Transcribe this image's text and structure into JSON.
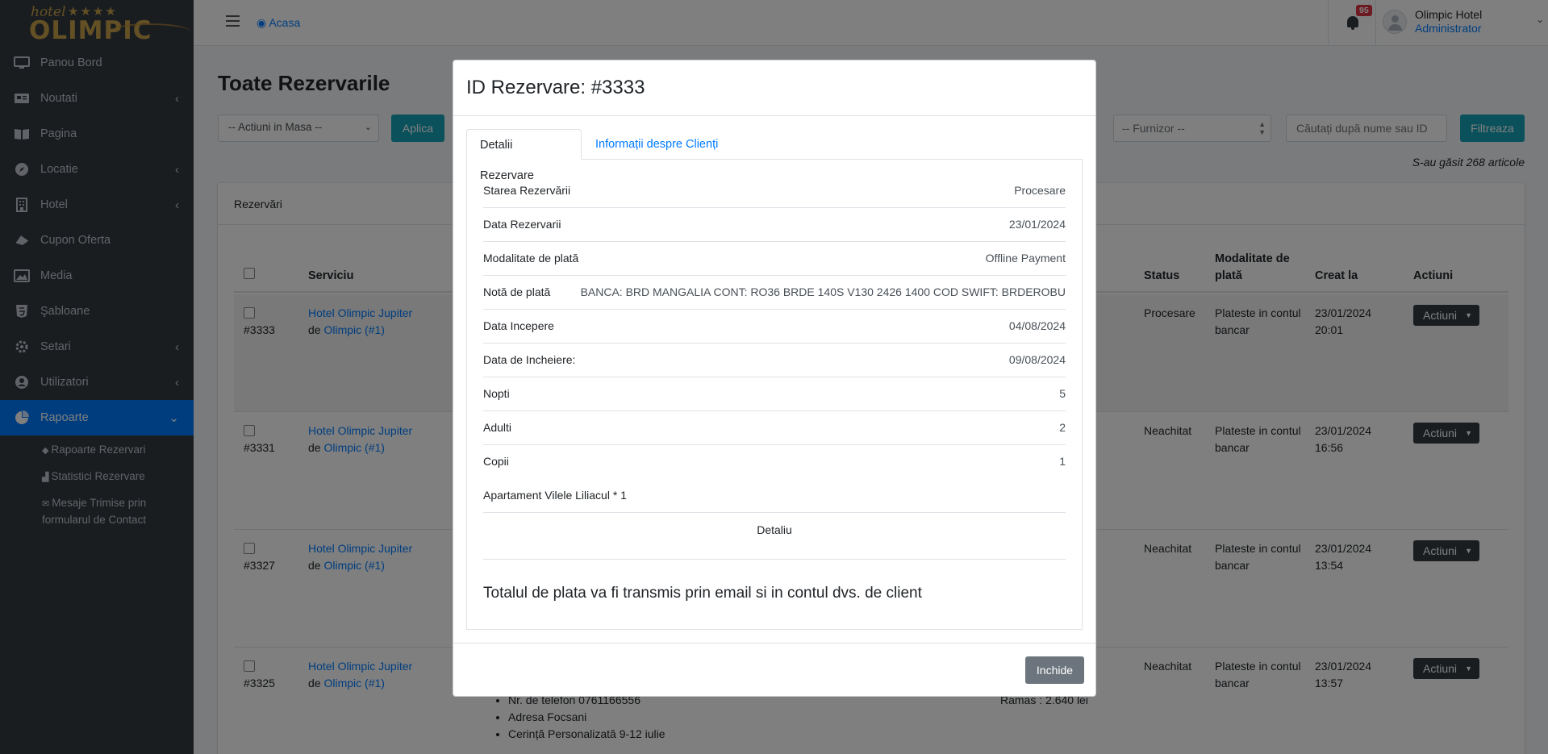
{
  "brand": {
    "script": "hotel",
    "stars": "★★★★",
    "word": "OLIMPIC"
  },
  "sidebar": {
    "items": [
      {
        "label": "Panou Bord",
        "icon": "desktop-icon"
      },
      {
        "label": "Noutati",
        "icon": "newspaper-icon"
      },
      {
        "label": "Pagina",
        "icon": "book-icon"
      },
      {
        "label": "Locatie",
        "icon": "compass-icon"
      },
      {
        "label": "Hotel",
        "icon": "building-icon"
      },
      {
        "label": "Cupon Oferta",
        "icon": "ticket-icon"
      },
      {
        "label": "Media",
        "icon": "image-icon"
      },
      {
        "label": "Şabloane",
        "icon": "html5-icon"
      },
      {
        "label": "Setari",
        "icon": "cogs-icon"
      },
      {
        "label": "Utilizatori",
        "icon": "user-circle-icon"
      },
      {
        "label": "Rapoarte",
        "icon": "pie-chart-icon"
      }
    ],
    "sub": [
      {
        "label": "Rapoarte Rezervari"
      },
      {
        "label": "Statistici Rezervare"
      },
      {
        "label": "Mesaje Trimise prin formularul de Contact"
      }
    ]
  },
  "topbar": {
    "home": "Acasa",
    "notif_count": "95",
    "user_name": "Olimpic Hotel",
    "user_role": "Administrator"
  },
  "page": {
    "title": "Toate Rezervarile",
    "bulk_select": "-- Actiuni in Masa --",
    "apply": "Aplica",
    "provider_select": "-- Furnizor --",
    "search_placeholder": "Căutați după nume sau ID",
    "filter": "Filtreaza",
    "found": "S-au găsit 268 articole",
    "card_title": "Rezervări"
  },
  "table": {
    "headers": {
      "service": "Serviciu",
      "status": "Status",
      "payment": "Modalitate de plată",
      "created": "Creat la",
      "actions": "Actiuni"
    },
    "rows": [
      {
        "id": "#3333",
        "service": "Hotel Olimpic Jupiter",
        "de": "de",
        "vendor": "Olimpic (#1)",
        "status": "Procesare",
        "payment": "Plateste in contul bancar",
        "created_date": "23/01/2024",
        "created_time": "20:01",
        "action": "Actiuni"
      },
      {
        "id": "#3331",
        "service": "Hotel Olimpic Jupiter",
        "de": "de",
        "vendor": "Olimpic (#1)",
        "status": "Neachitat",
        "payment": "Plateste in contul bancar",
        "created_date": "23/01/2024",
        "created_time": "16:56",
        "action": "Actiuni"
      },
      {
        "id": "#3327",
        "service": "Hotel Olimpic Jupiter",
        "de": "de",
        "vendor": "Olimpic (#1)",
        "status": "Neachitat",
        "payment": "Plateste in contul bancar",
        "created_date": "23/01/2024",
        "created_time": "13:54",
        "action": "Actiuni"
      },
      {
        "id": "#3325",
        "service": "Hotel Olimpic Jupiter",
        "de": "de",
        "vendor": "Olimpic (#1)",
        "status": "Neachitat",
        "payment": "Plateste in contul bancar",
        "created_date": "23/01/2024",
        "created_time": "13:57",
        "action": "Actiuni"
      }
    ],
    "row4_extra": {
      "phone": "Nr. de telefon 0761166556",
      "address": "Adresa Focsani",
      "request": "Cerință Personalizată 9-12 iulie",
      "remaining": "Ramas : 2.640 lei"
    }
  },
  "modal": {
    "title": "ID Rezervare: #3333",
    "tab_details": "Detalii Rezervare",
    "tab_client": "Informații despre Clienți",
    "details": [
      {
        "label": "Starea Rezervării",
        "value": "Procesare"
      },
      {
        "label": "Data Rezervarii",
        "value": "23/01/2024"
      },
      {
        "label": "Modalitate de plată",
        "value": "Offline Payment"
      },
      {
        "label": "Notă de plată",
        "value": "BANCA: BRD MANGALIA CONT: RO36 BRDE 140S V130 2426 1400 COD SWIFT: BRDEROBU"
      },
      {
        "label": "Data Incepere",
        "value": "04/08/2024"
      },
      {
        "label": "Data de Incheiere:",
        "value": "09/08/2024"
      },
      {
        "label": "Nopti",
        "value": "5"
      },
      {
        "label": "Adulti",
        "value": "2"
      },
      {
        "label": "Copii",
        "value": "1"
      },
      {
        "label": "Apartament Vilele Liliacul * 1",
        "value": ""
      }
    ],
    "detail_button": "Detaliu",
    "total_note": "Totalul de plata va fi transmis prin email si in contul dvs. de client",
    "close": "Inchide"
  }
}
